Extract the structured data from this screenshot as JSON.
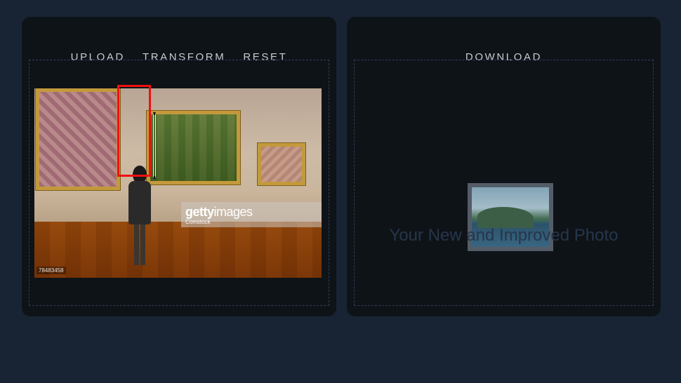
{
  "left_panel": {
    "nav": {
      "upload": "UPLOAD",
      "transform": "TRANSFORM",
      "reset": "RESET"
    },
    "photo": {
      "watermark_logo_bold": "getty",
      "watermark_logo_light": "images",
      "watermark_sub": "Comstock",
      "image_id": "78483458"
    },
    "selection_color": "#f01010"
  },
  "right_panel": {
    "nav": {
      "download": "DOWNLOAD"
    },
    "placeholder_caption": "Your New and Improved Photo"
  },
  "colors": {
    "background": "#182434",
    "panel": "#0e1318",
    "nav_text": "#c9ccd0",
    "caption_text": "#26364a"
  }
}
